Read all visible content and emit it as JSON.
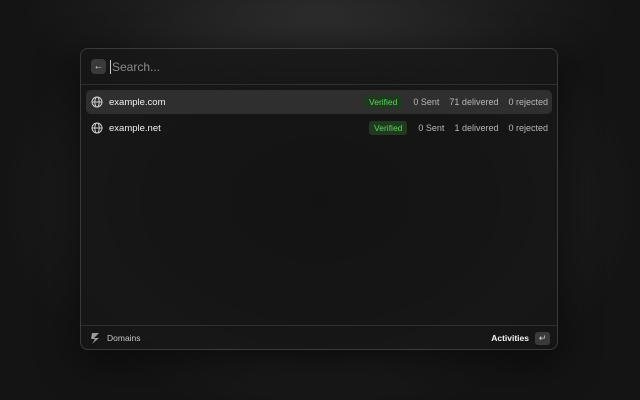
{
  "search": {
    "placeholder": "Search...",
    "value": "",
    "back_icon": "arrow-left-icon"
  },
  "domains": [
    {
      "name": "example.com",
      "status": "Verified",
      "sent": "0 Sent",
      "delivered": "71 delivered",
      "rejected": "0 rejected",
      "selected": true
    },
    {
      "name": "example.net",
      "status": "Verified",
      "sent": "0 Sent",
      "delivered": "1 delivered",
      "rejected": "0 rejected",
      "selected": false
    }
  ],
  "footer": {
    "section_label": "Domains",
    "action_label": "Activities",
    "action_key": "↵"
  },
  "colors": {
    "verified_text": "#5ed35e",
    "verified_bg": "#1f3a1f",
    "selected_row": "#2f2f2f"
  }
}
